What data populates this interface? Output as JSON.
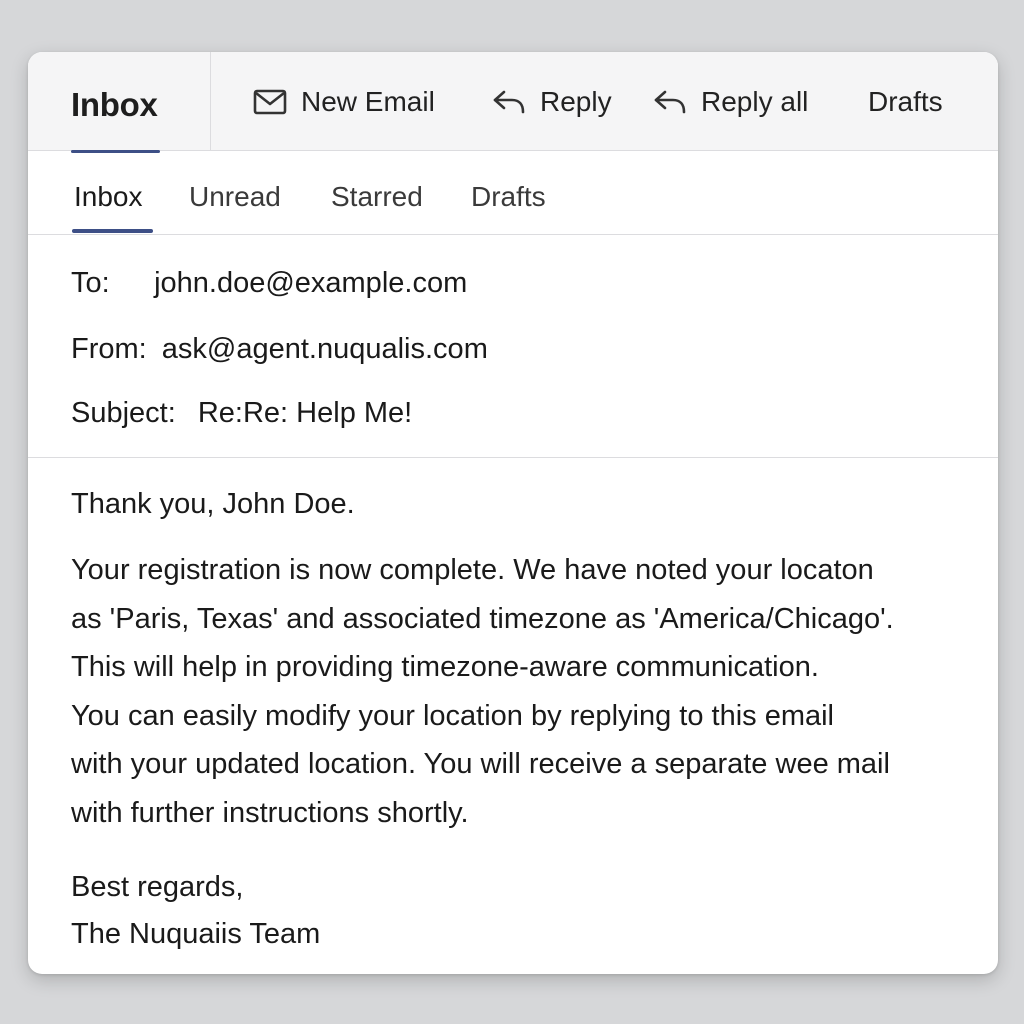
{
  "toolbar": {
    "title": "Inbox",
    "new_email": {
      "label": "New Email",
      "icon": "envelope-icon"
    },
    "reply": {
      "label": "Reply",
      "icon": "reply-arrow-icon"
    },
    "reply_all": {
      "label": "Reply all",
      "icon": "reply-all-arrow-icon"
    },
    "drafts": {
      "label": "Drafts"
    }
  },
  "tabs": [
    {
      "label": "Inbox",
      "active": true
    },
    {
      "label": "Unread",
      "active": false
    },
    {
      "label": "Starred",
      "active": false
    },
    {
      "label": "Drafts",
      "active": false
    }
  ],
  "email": {
    "to_label": "To:",
    "to": "john.doe@example.com",
    "from_label": "From:",
    "from": "ask@agent.nuqualis.com",
    "subject_label": "Subject:",
    "subject": "Re:Re: Help Me!",
    "greeting": "Thank you, John Doe.",
    "body_lines": [
      "Your registration is now complete. We have noted your locaton",
      "as 'Paris, Texas' and associated timezone as 'America/Chicago'.",
      "This will help in providing timezone-aware communication.",
      "You can easily modify your location by replying to this email",
      "with your updated location. You will receive a separate wee mail",
      "with further instructions shortly."
    ],
    "signoff": "Best regards,",
    "signature": "The Nuquaiis Team"
  },
  "colors": {
    "background": "#d6d7d9",
    "toolbar_bg": "#f5f5f6",
    "accent": "#3d4f86",
    "divider": "#dcdcdf"
  }
}
